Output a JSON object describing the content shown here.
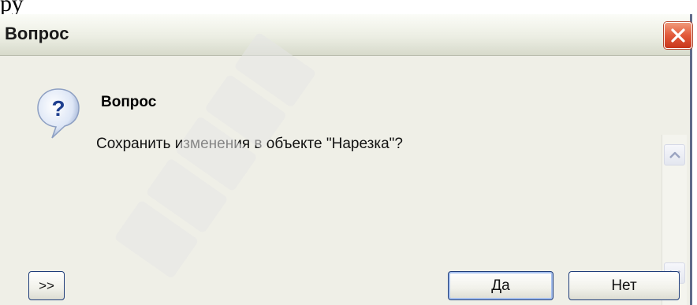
{
  "document": {
    "partial_text_above": "ру"
  },
  "dialog": {
    "title": "Вопрос",
    "heading": "Вопрос",
    "message": "Сохранить изменения в объекте \"Нарезка\"?",
    "icon": "question-icon",
    "buttons": {
      "expand_label": ">>",
      "yes_label": "Да",
      "no_label": "Нет"
    }
  },
  "colors": {
    "close_button": "#e2593a",
    "dialog_background": "#efefe7",
    "button_border": "#1f3d7a"
  }
}
